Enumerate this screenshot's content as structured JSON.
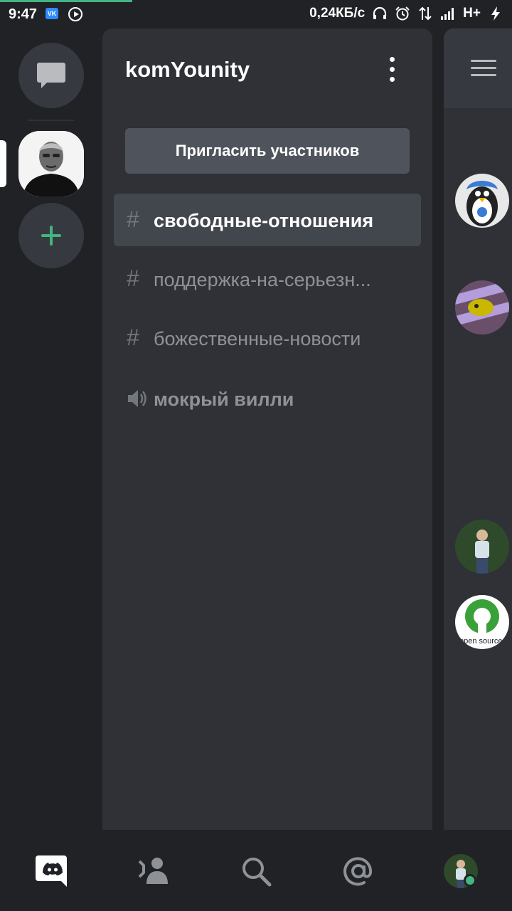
{
  "status_bar": {
    "time": "9:47",
    "vk_label": "VK",
    "net_speed": "0,24КБ/с",
    "network_type": "H+",
    "icons": [
      "vk-icon",
      "play-icon",
      "headphones-icon",
      "alarm-icon",
      "data-transfer-icon",
      "signal-icon",
      "charging-icon"
    ]
  },
  "server_rail": {
    "items": [
      "direct-messages-icon",
      "server-avatar",
      "add-server-icon"
    ],
    "accent": "#43b581"
  },
  "channel_panel": {
    "server_name": "komYounity",
    "invite_label": "Пригласить участников",
    "channels": [
      {
        "type": "text",
        "icon": "#",
        "name": "свободные-отношения",
        "active": true
      },
      {
        "type": "text",
        "icon": "#",
        "name": "поддержка-на-серьезн...",
        "active": false
      },
      {
        "type": "text",
        "icon": "#",
        "name": "божественные-новости",
        "active": false
      },
      {
        "type": "voice",
        "icon": "speaker-icon",
        "name": "мокрый вилли",
        "active": false
      }
    ]
  },
  "member_peek": {
    "avatars": [
      "penguin-avatar",
      "creature-avatar",
      "person-avatar",
      "open-source-avatar"
    ],
    "open_source_text": "open source"
  },
  "bottom_nav": {
    "items": [
      "discord-icon",
      "friends-icon",
      "search-icon",
      "mentions-icon",
      "profile-avatar"
    ],
    "status": "online",
    "status_color": "#43b581"
  },
  "colors": {
    "background": "#202225",
    "panel": "#2f3136",
    "active_channel": "#42464d",
    "invite_button": "#4f545c"
  }
}
